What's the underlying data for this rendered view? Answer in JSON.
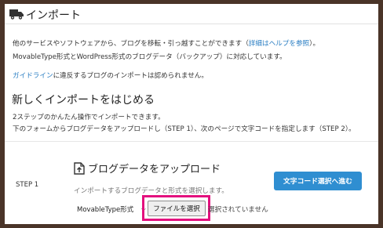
{
  "header": {
    "title": "インポート"
  },
  "intro": {
    "line1_text": "他のサービスやソフトウェアから、ブログを移転・引っ越すことができます（",
    "line1_link": "詳細はヘルプを参照",
    "line1_end": "）。",
    "line2": "MovableType形式とWordPress形式のブログデータ（バックアップ）に対応しています。",
    "guideline_link": "ガイドライン",
    "guideline_text": "に違反するブログのインポートは認められません。"
  },
  "new_import": {
    "heading": "新しくインポートをはじめる",
    "desc1": "2ステップのかんたん操作でインポートできます。",
    "desc2": "下のフォームからブログデータをアップロードし（STEP 1）、次のページで文字コードを指定します（STEP 2）。"
  },
  "step1": {
    "label": "STEP 1",
    "title": "ブログデータをアップロード",
    "description": "インポートするブログデータと形式を選択します。",
    "format_select": "MovableType形式",
    "file_button": "ファイルを選択",
    "file_status": "選択されていません",
    "next_button": "文字コード選択へ進む"
  },
  "colors": {
    "accent": "#2f8ed1",
    "link": "#2a7ec3",
    "highlight": "#e3117e",
    "frame": "#4a3428"
  }
}
